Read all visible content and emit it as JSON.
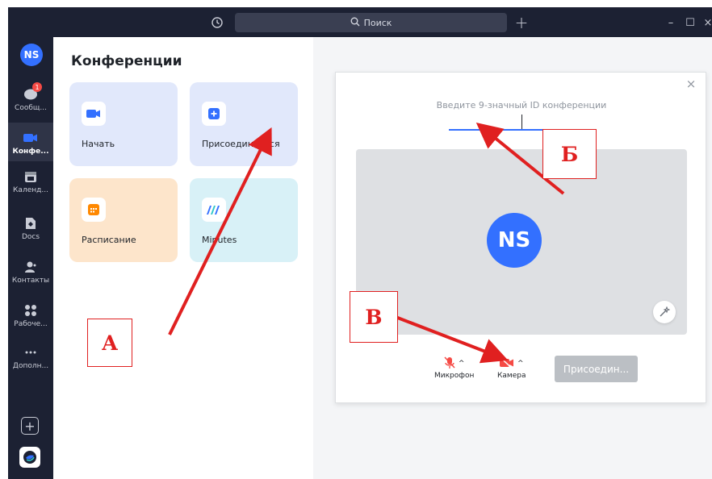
{
  "search": {
    "label": "Поиск"
  },
  "user": {
    "initials": "NS"
  },
  "sidebar": {
    "items": [
      {
        "label": "Сообщ...",
        "icon": "chat-bubble-icon",
        "badge": "1"
      },
      {
        "label": "Конфе...",
        "icon": "video-camera-icon",
        "active": true
      },
      {
        "label": "Календ...",
        "icon": "calendar-icon"
      },
      {
        "label": "Docs",
        "icon": "docs-icon"
      },
      {
        "label": "Контакты",
        "icon": "contacts-icon"
      },
      {
        "label": "Рабоче...",
        "icon": "workplace-grid-icon"
      },
      {
        "label": "Дополн...",
        "icon": "more-dots-icon"
      }
    ]
  },
  "panel": {
    "title": "Конференции",
    "cards": [
      {
        "label": "Начать",
        "icon": "video-camera-icon",
        "bg": "#e1e8fb",
        "icon_color": "#3370ff"
      },
      {
        "label": "Присоединиться",
        "icon": "plus-square-icon",
        "bg": "#e1e8fb",
        "icon_color": "#3370ff"
      },
      {
        "label": "Расписание",
        "icon": "calendar-grid-icon",
        "bg": "#fde5cb",
        "icon_color": "#ff8800"
      },
      {
        "label": "Minutes",
        "icon": "minutes-logo-icon",
        "bg": "#d8f1f7",
        "icon_color": "#3370ff"
      }
    ]
  },
  "dialog": {
    "id_label": "Введите 9-значный ID конференции",
    "mic_label": "Микрофон",
    "camera_label": "Камера",
    "join_label": "Присоедин..."
  },
  "annotations": {
    "label_a": "А",
    "label_b": "Б",
    "label_v": "В",
    "color": "#e02020"
  },
  "colors": {
    "accent": "#3370ff",
    "sidebar_bg": "#1c2133",
    "badge": "#f54a45",
    "muted_red": "#f54a45"
  }
}
